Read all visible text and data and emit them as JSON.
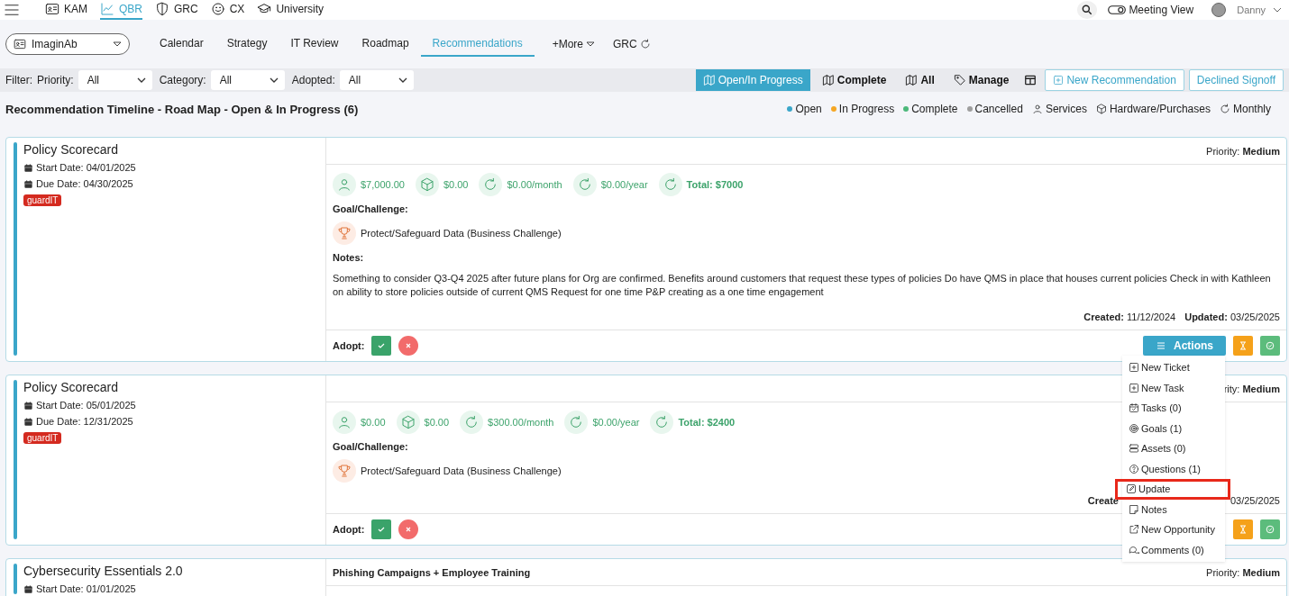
{
  "nav": {
    "modules": [
      {
        "label": "KAM",
        "kind": "idcard",
        "selected": false
      },
      {
        "label": "QBR",
        "kind": "chart",
        "selected": true
      },
      {
        "label": "GRC",
        "kind": "shield",
        "selected": false
      },
      {
        "label": "CX",
        "kind": "smile",
        "selected": false
      },
      {
        "label": "University",
        "kind": "cap",
        "selected": false
      }
    ],
    "meeting_view": "Meeting View",
    "user": "Danny"
  },
  "company_select": "ImaginAb",
  "tabs": [
    {
      "label": "Calendar",
      "selected": false
    },
    {
      "label": "Strategy",
      "selected": false
    },
    {
      "label": "IT Review",
      "selected": false
    },
    {
      "label": "Roadmap",
      "selected": false
    },
    {
      "label": "Recommendations",
      "selected": true
    }
  ],
  "more": "+More",
  "grc_link": "GRC",
  "filter": {
    "label": "Filter:",
    "fields": [
      {
        "label": "Priority:",
        "value": "All"
      },
      {
        "label": "Category:",
        "value": "All"
      },
      {
        "label": "Adopted:",
        "value": "All"
      }
    ]
  },
  "views": [
    {
      "label": "Open/In Progress",
      "kind": "map",
      "selected": true
    },
    {
      "label": "Complete",
      "kind": "map",
      "selected": false
    },
    {
      "label": "All",
      "kind": "map",
      "selected": false
    },
    {
      "label": "Manage",
      "kind": "tag",
      "selected": false
    }
  ],
  "new_button": "New Recommendation",
  "declined_button": "Declined Signoff",
  "heading": "Recommendation Timeline - Road Map - Open & In Progress (6)",
  "legend": [
    {
      "label": "Open",
      "color": "#3aa6c9"
    },
    {
      "label": "In Progress",
      "color": "#f5a623"
    },
    {
      "label": "Complete",
      "color": "#4cb87a"
    },
    {
      "label": "Cancelled",
      "color": "#9e9e9e"
    }
  ],
  "icon_legend": [
    {
      "label": "Services",
      "kind": "person"
    },
    {
      "label": "Hardware/Purchases",
      "kind": "cube"
    },
    {
      "label": "Monthly",
      "kind": "refresh"
    }
  ],
  "cards": [
    {
      "title": "Policy Scorecard",
      "start": "Start Date: 04/01/2025",
      "due": "Due Date: 04/30/2025",
      "tag": "guardIT",
      "priority_label": "Priority:",
      "priority": "Medium",
      "costs": [
        {
          "kind": "services",
          "text": "$7,000.00"
        },
        {
          "kind": "hardware",
          "text": "$0.00"
        },
        {
          "kind": "monthly",
          "text": "$0.00/month"
        },
        {
          "kind": "yearly",
          "text": "$0.00/year"
        },
        {
          "kind": "total",
          "text": "Total: $7000"
        }
      ],
      "goal_label": "Goal/Challenge:",
      "goal": "Protect/Safeguard Data (Business Challenge)",
      "notes_label": "Notes:",
      "notes": "Something to consider Q3-Q4 2025 after future plans for Org are confirmed. Benefits around customers that request these types of policies Do have QMS in place that houses current policies Check in with Kathleen on ability to store policies outside of current QMS Request for one time P&P creating as a one time engagement",
      "created_label": "Created:",
      "created": "11/12/2024",
      "updated_label": "Updated:",
      "updated": "03/25/2025",
      "adopt_label": "Adopt:",
      "actions": [
        {
          "kind": "actions",
          "label": "Actions"
        },
        {
          "kind": "hourglass"
        },
        {
          "kind": "done"
        }
      ]
    },
    {
      "title": "Policy Scorecard",
      "start": "Start Date: 05/01/2025",
      "due": "Due Date: 12/31/2025",
      "tag": "guardIT",
      "priority_label": "rity:",
      "priority": "Medium",
      "costs": [
        {
          "kind": "services",
          "text": "$0.00"
        },
        {
          "kind": "hardware",
          "text": "$0.00"
        },
        {
          "kind": "monthly",
          "text": "$300.00/month"
        },
        {
          "kind": "yearly",
          "text": "$0.00/year"
        },
        {
          "kind": "total",
          "text": "Total: $2400"
        }
      ],
      "goal_label": "Goal/Challenge:",
      "goal": "Protect/Safeguard Data (Business Challenge)",
      "created_label": "Create",
      "updated": "03/25/2025",
      "adopt_label": "Adopt:",
      "actions": [
        {
          "kind": "hourglass"
        },
        {
          "kind": "done"
        }
      ]
    },
    {
      "title": "Cybersecurity Essentials 2.0",
      "start": "Start Date: 01/01/2025",
      "header": "Phishing Campaigns + Employee Training",
      "priority_label": "Priority:",
      "priority": "Medium"
    }
  ],
  "menu": [
    {
      "label": "New Ticket",
      "kind": "plus",
      "highlighted": false
    },
    {
      "label": "New Task",
      "kind": "plus",
      "highlighted": false
    },
    {
      "label": "Tasks (0)",
      "kind": "calendar",
      "highlighted": false
    },
    {
      "label": "Goals (1)",
      "kind": "target",
      "highlighted": false
    },
    {
      "label": "Assets (0)",
      "kind": "stack",
      "highlighted": false
    },
    {
      "label": "Questions (1)",
      "kind": "question",
      "highlighted": false
    },
    {
      "label": "Update",
      "kind": "edit",
      "highlighted": true
    },
    {
      "label": "Notes",
      "kind": "note",
      "highlighted": false
    },
    {
      "label": "New Opportunity",
      "kind": "external",
      "highlighted": false
    },
    {
      "label": "Comments (0)",
      "kind": "comments",
      "highlighted": false
    }
  ]
}
